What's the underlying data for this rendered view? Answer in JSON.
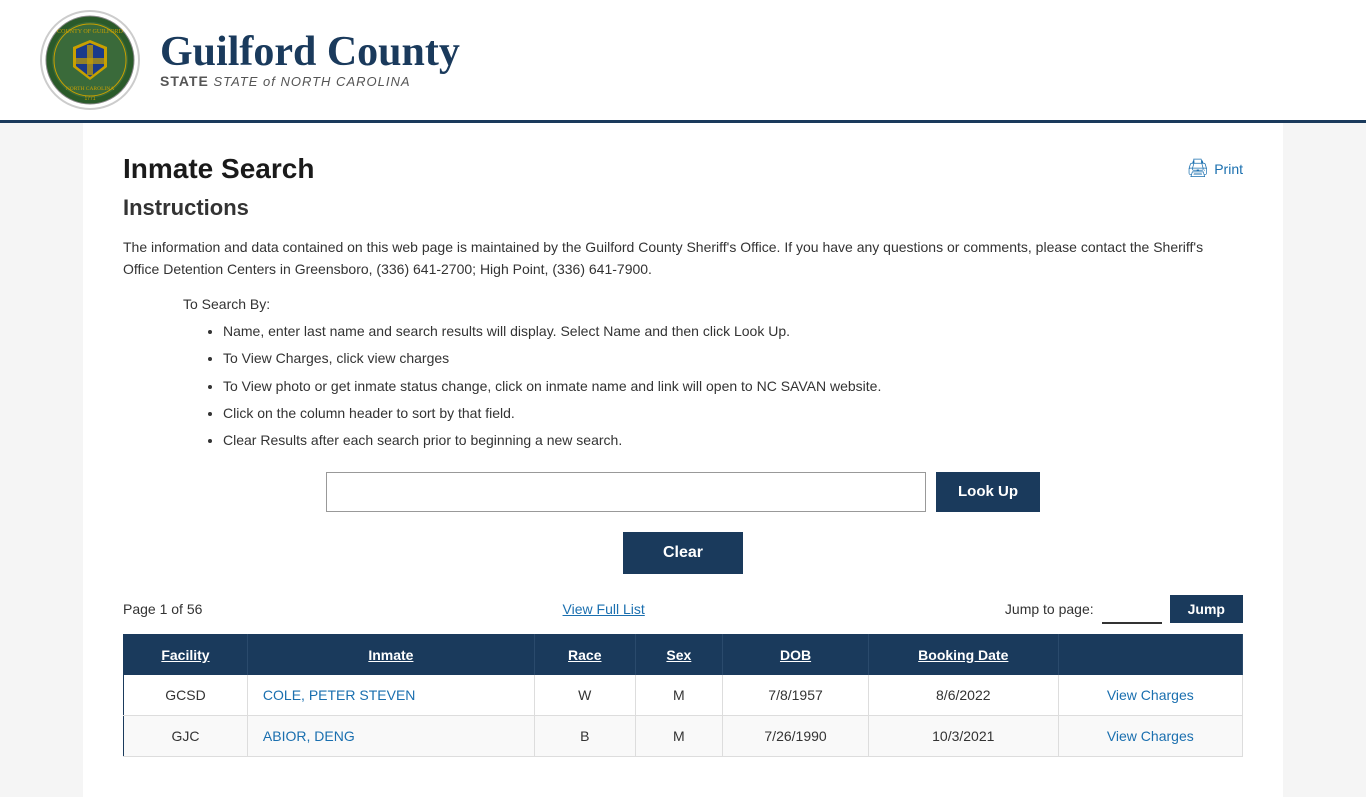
{
  "header": {
    "county_name": "Guilford County",
    "state_label": "STATE of NORTH CAROLINA",
    "print_label": "Print"
  },
  "page": {
    "title": "Inmate Search",
    "instructions_title": "Instructions",
    "instructions_body": "The information and data contained on this web page is maintained by the Guilford County Sheriff's Office. If you have any questions or comments, please contact the Sheriff's Office Detention Centers in Greensboro, (336) 641-2700; High Point, (336) 641-7900.",
    "search_by_label": "To Search By:",
    "bullets": [
      "Name, enter last name and search results will display. Select Name and then click Look Up.",
      "To View Charges, click view charges",
      "To View photo or get inmate status change, click on inmate name and link will open to NC SAVAN website.",
      "Click on the column header to sort by that field.",
      "Clear Results after each search prior to beginning a new search."
    ]
  },
  "search": {
    "input_placeholder": "",
    "input_value": "",
    "lookup_button": "Look Up",
    "clear_button": "Clear"
  },
  "results": {
    "page_info": "Page 1 of 56",
    "view_full_list": "View Full List",
    "jump_label": "Jump to page:",
    "jump_button": "Jump",
    "columns": [
      "Facility",
      "Inmate",
      "Race",
      "Sex",
      "DOB",
      "Booking Date",
      ""
    ],
    "rows": [
      {
        "facility": "GCSD",
        "inmate": "COLE, PETER STEVEN",
        "race": "W",
        "sex": "M",
        "dob": "7/8/1957",
        "booking_date": "8/6/2022",
        "action": "View Charges"
      },
      {
        "facility": "GJC",
        "inmate": "ABIOR, DENG",
        "race": "B",
        "sex": "M",
        "dob": "7/26/1990",
        "booking_date": "10/3/2021",
        "action": "View Charges"
      }
    ]
  }
}
